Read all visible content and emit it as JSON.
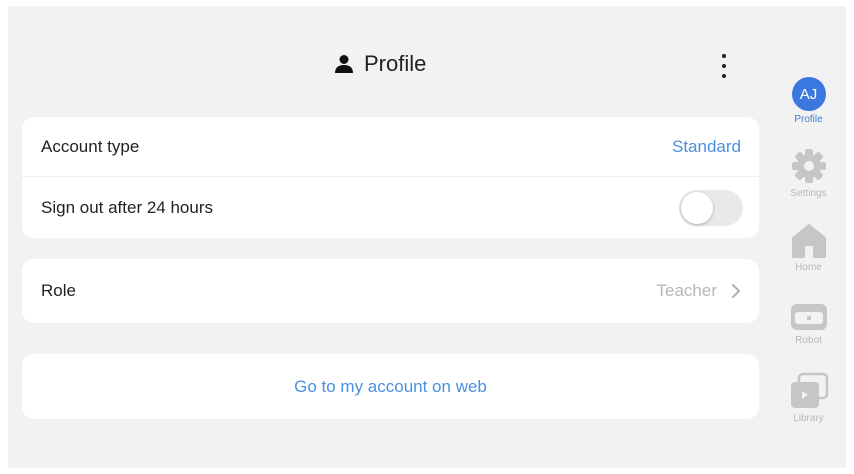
{
  "header": {
    "title": "Profile",
    "title_icon": "person-icon",
    "menu_icon": "kebab-menu-icon"
  },
  "account": {
    "type_label": "Account type",
    "type_value": "Standard",
    "signout_label": "Sign out after 24 hours",
    "signout_enabled": false
  },
  "role": {
    "label": "Role",
    "value": "Teacher"
  },
  "web_link": {
    "label": "Go to my account on web"
  },
  "sidebar": {
    "avatar_initials": "AJ",
    "items": [
      {
        "label": "Profile",
        "icon": "avatar",
        "active": true
      },
      {
        "label": "Settings",
        "icon": "gear-icon",
        "active": false
      },
      {
        "label": "Home",
        "icon": "home-icon",
        "active": false
      },
      {
        "label": "Robot",
        "icon": "robot-icon",
        "active": false
      },
      {
        "label": "Library",
        "icon": "library-icon",
        "active": false
      }
    ]
  },
  "colors": {
    "accent": "#4a90e2",
    "active_nav": "#3f7fd9",
    "inactive_icon": "#c6c6c6",
    "background": "#f2f2f2"
  }
}
